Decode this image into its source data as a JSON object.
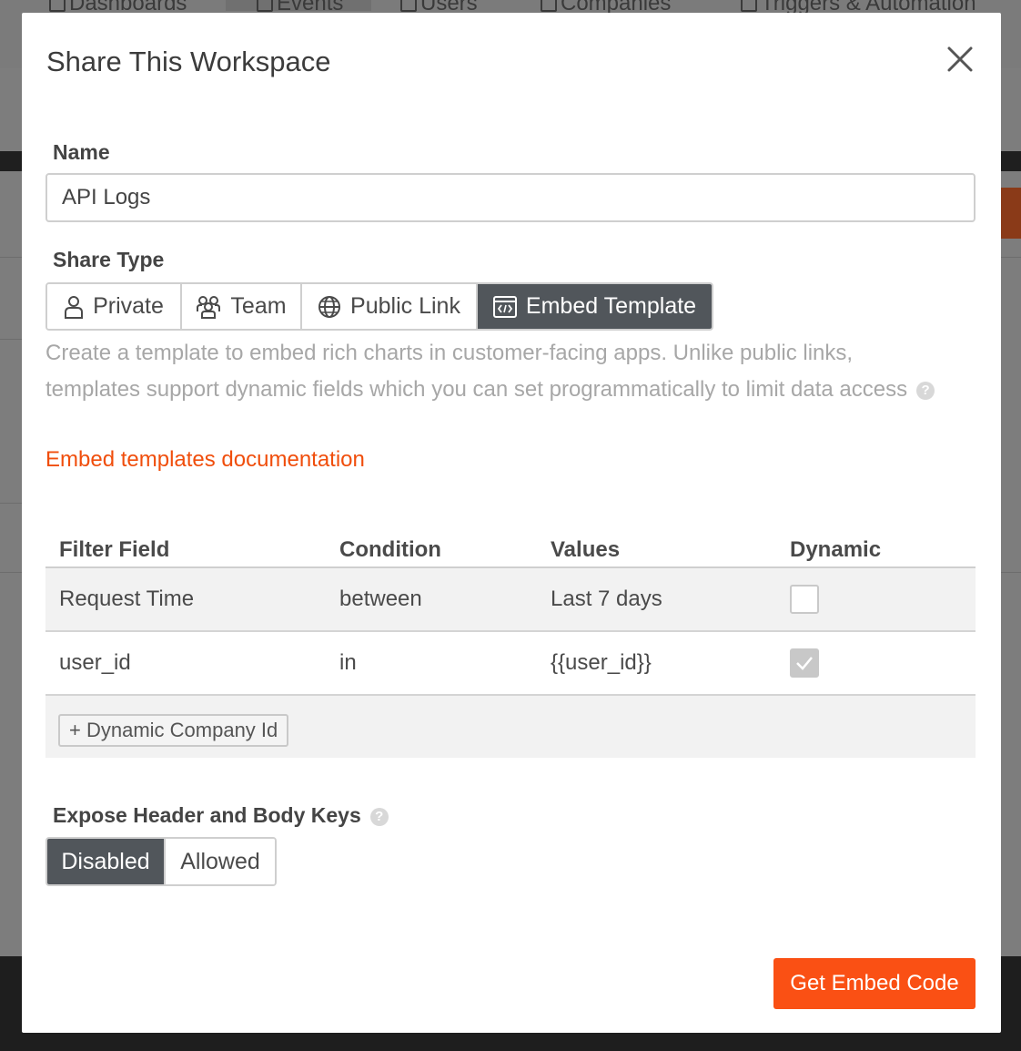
{
  "background": {
    "nav": [
      "Dashboards",
      "Events",
      "Users",
      "Companies",
      "Triggers & Automation"
    ]
  },
  "modal": {
    "title": "Share This Workspace",
    "close_icon": "close-icon"
  },
  "name_field": {
    "label": "Name",
    "value": "API Logs"
  },
  "share_type": {
    "label": "Share Type",
    "options": [
      {
        "label": "Private",
        "icon": "person-icon",
        "active": false
      },
      {
        "label": "Team",
        "icon": "team-icon",
        "active": false
      },
      {
        "label": "Public Link",
        "icon": "globe-icon",
        "active": false
      },
      {
        "label": "Embed Template",
        "icon": "embed-code-icon",
        "active": true
      }
    ],
    "description": "Create a template to embed rich charts in customer-facing apps. Unlike public links, templates support dynamic fields which you can set programmatically to limit data access",
    "help_icon": "?",
    "doc_link": "Embed templates documentation"
  },
  "filters": {
    "columns": [
      "Filter Field",
      "Condition",
      "Values",
      "Dynamic"
    ],
    "rows": [
      {
        "field": "Request Time",
        "condition": "between",
        "values": "Last 7 days",
        "dynamic": false
      },
      {
        "field": "user_id",
        "condition": "in",
        "values": "{{user_id}}",
        "dynamic": true
      }
    ],
    "add_button": "+ Dynamic Company Id"
  },
  "expose_keys": {
    "label": "Expose Header and Body Keys",
    "help_icon": "?",
    "options": [
      {
        "label": "Disabled",
        "active": true
      },
      {
        "label": "Allowed",
        "active": false
      }
    ]
  },
  "footer": {
    "primary_button": "Get Embed Code"
  },
  "colors": {
    "accent": "#fa5014",
    "link": "#f04e0c",
    "active_segment": "#51565b"
  }
}
